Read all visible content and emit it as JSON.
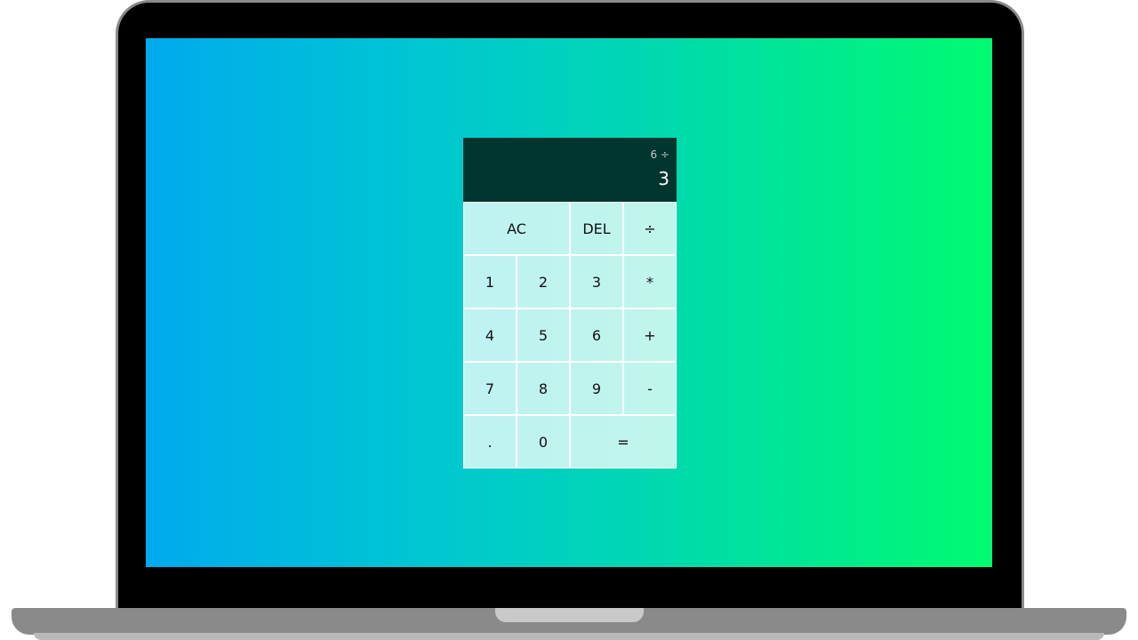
{
  "calculator": {
    "display": {
      "previous_operand": "6 ÷",
      "current_operand": "3"
    },
    "buttons": {
      "ac": "AC",
      "del": "DEL",
      "divide": "÷",
      "one": "1",
      "two": "2",
      "three": "3",
      "multiply": "*",
      "four": "4",
      "five": "5",
      "six": "6",
      "add": "+",
      "seven": "7",
      "eight": "8",
      "nine": "9",
      "subtract": "-",
      "decimal": ".",
      "zero": "0",
      "equals": "="
    }
  },
  "colors": {
    "display_background": "#00362e",
    "gradient_start": "#00aaee",
    "gradient_end": "#00fb70",
    "button_background": "rgba(255,255,255,0.75)"
  }
}
